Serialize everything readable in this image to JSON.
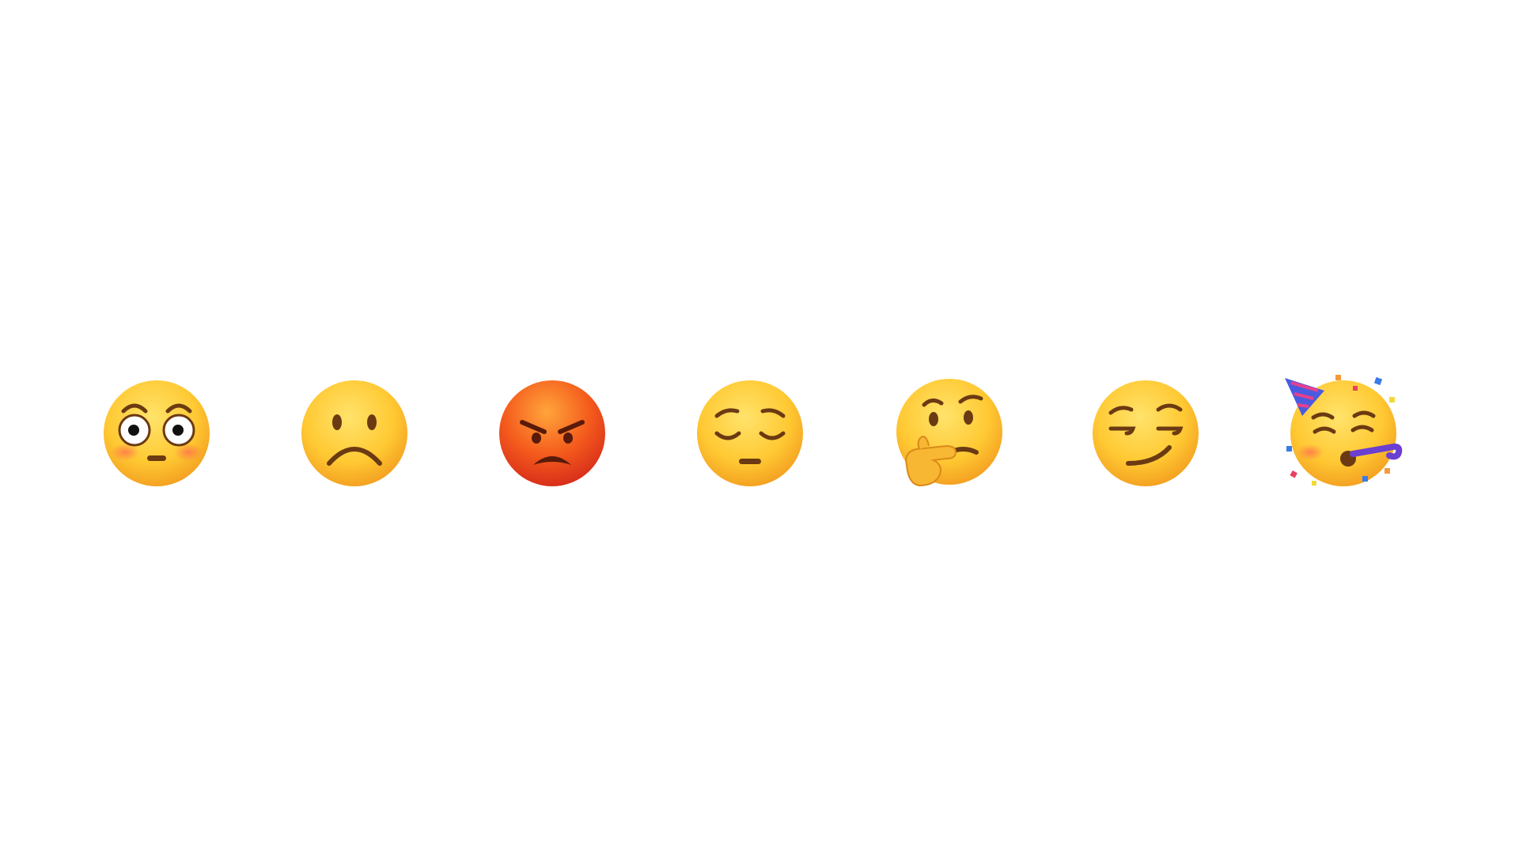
{
  "emojis": [
    {
      "name": "flushed-face",
      "icon": "flushed-face-icon",
      "colors": {
        "face": "#FFC933",
        "blush": "#FF8A5C"
      }
    },
    {
      "name": "frowning-face",
      "icon": "frowning-face-icon",
      "colors": {
        "face": "#FFC933"
      }
    },
    {
      "name": "pouting-face",
      "icon": "pouting-face-icon",
      "colors": {
        "face": "#F45A1C"
      }
    },
    {
      "name": "pensive-face",
      "icon": "pensive-face-icon",
      "colors": {
        "face": "#FFC933"
      }
    },
    {
      "name": "thinking-face",
      "icon": "thinking-face-icon",
      "colors": {
        "face": "#FFC933",
        "hand": "#F7B733"
      }
    },
    {
      "name": "smirking-face",
      "icon": "smirking-face-icon",
      "colors": {
        "face": "#FFC933"
      }
    },
    {
      "name": "partying-face",
      "icon": "partying-face-icon",
      "colors": {
        "face": "#FFC933",
        "hat": "#4A5BE0",
        "blower": "#6A3FD1"
      }
    }
  ],
  "feature_color": "#6B3A12",
  "background": "#FFFFFF"
}
